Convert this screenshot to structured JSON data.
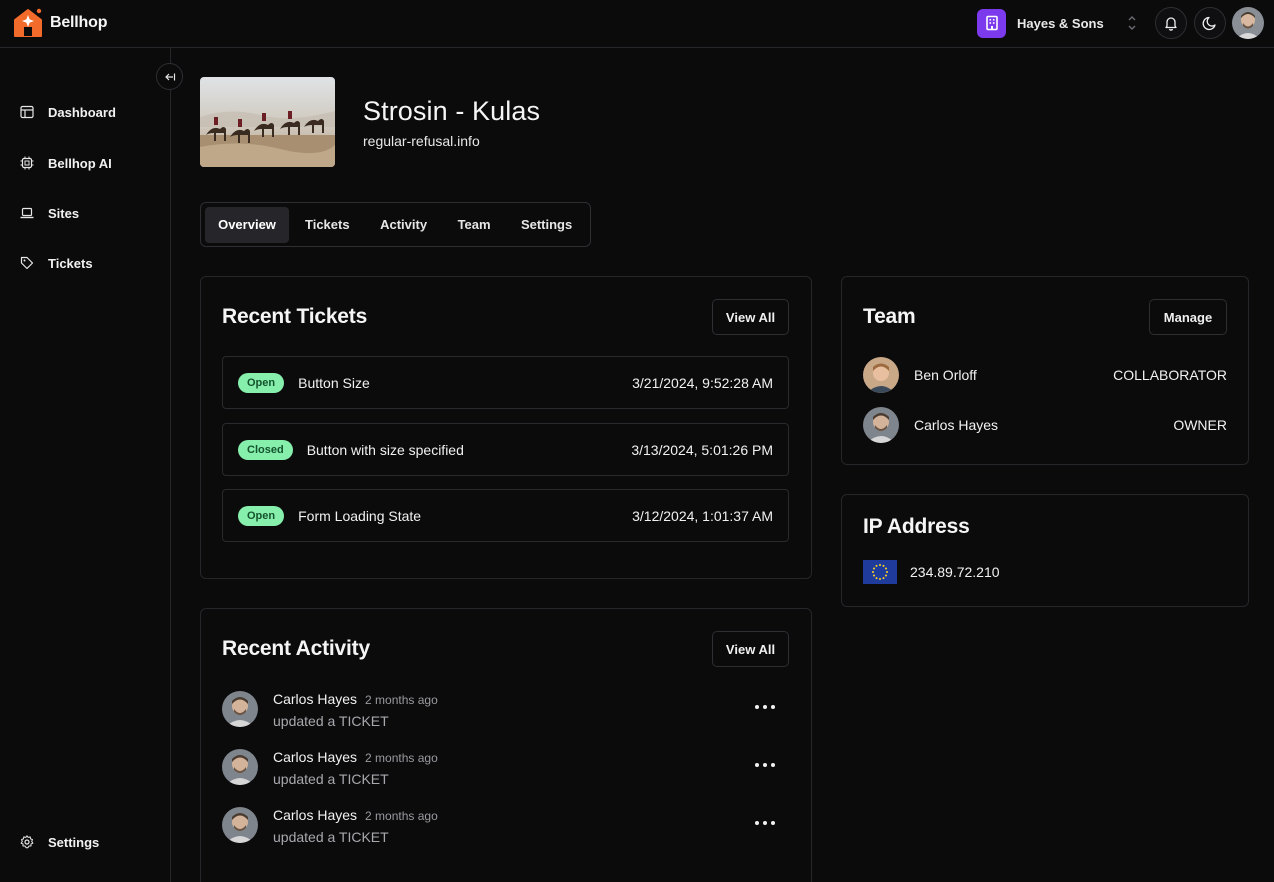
{
  "app": {
    "name": "Bellhop"
  },
  "header": {
    "org_name": "Hayes & Sons",
    "icons": [
      "bell-icon",
      "moon-icon"
    ]
  },
  "sidebar": {
    "items": [
      {
        "label": "Dashboard",
        "icon": "layout-icon"
      },
      {
        "label": "Bellhop AI",
        "icon": "chip-icon"
      },
      {
        "label": "Sites",
        "icon": "laptop-icon"
      },
      {
        "label": "Tickets",
        "icon": "tag-icon"
      }
    ],
    "settings_label": "Settings"
  },
  "site": {
    "title": "Strosin - Kulas",
    "domain": "regular-refusal.info"
  },
  "tabs": [
    "Overview",
    "Tickets",
    "Activity",
    "Team",
    "Settings"
  ],
  "active_tab": "Overview",
  "recent_tickets": {
    "title": "Recent Tickets",
    "view_all": "View All",
    "items": [
      {
        "status": "Open",
        "name": "Button Size",
        "date": "3/21/2024, 9:52:28 AM"
      },
      {
        "status": "Closed",
        "name": "Button with size specified",
        "date": "3/13/2024, 5:01:26 PM"
      },
      {
        "status": "Open",
        "name": "Form Loading State",
        "date": "3/12/2024, 1:01:37 AM"
      }
    ]
  },
  "recent_activity": {
    "title": "Recent Activity",
    "view_all": "View All",
    "items": [
      {
        "user": "Carlos Hayes",
        "time": "2 months ago",
        "action": "updated a TICKET"
      },
      {
        "user": "Carlos Hayes",
        "time": "2 months ago",
        "action": "updated a TICKET"
      },
      {
        "user": "Carlos Hayes",
        "time": "2 months ago",
        "action": "updated a TICKET"
      }
    ]
  },
  "team": {
    "title": "Team",
    "manage": "Manage",
    "members": [
      {
        "name": "Ben Orloff",
        "role": "COLLABORATOR"
      },
      {
        "name": "Carlos Hayes",
        "role": "OWNER"
      }
    ]
  },
  "ip": {
    "title": "IP Address",
    "value": "234.89.72.210",
    "flag": "eu-flag"
  },
  "colors": {
    "background": "#0b0b0c",
    "border": "#26262a",
    "badge_bg": "#86efac",
    "badge_text": "#14532d",
    "brand": "#f26b2a",
    "org_accent": "#7c3aed"
  }
}
